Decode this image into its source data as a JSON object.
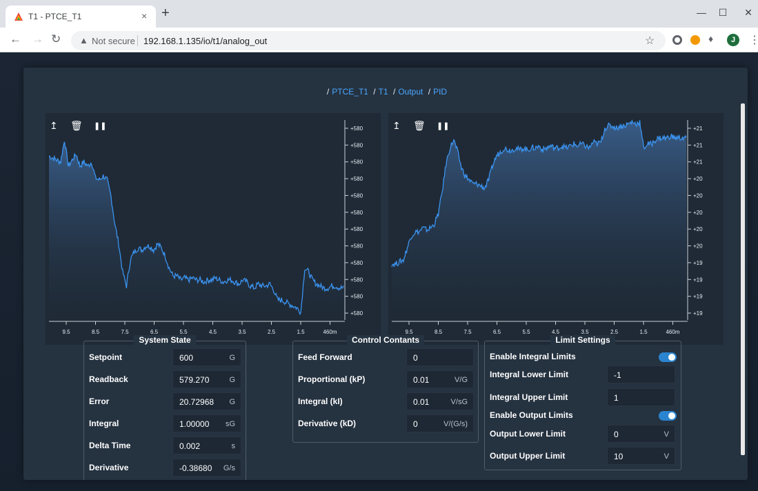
{
  "browser": {
    "tab_title": "T1 - PTCE_T1",
    "tab_close": "×",
    "new_tab": "+",
    "security_label": "Not secure",
    "url": "192.168.1.135/io/t1/analog_out",
    "avatar_letter": "J"
  },
  "breadcrumb": [
    "PTCE_T1",
    "T1",
    "Output",
    "PID"
  ],
  "charts": {
    "x_ticks": [
      "9.5",
      "8.5",
      "7.5",
      "6.5",
      "5.5",
      "4.5",
      "3.5",
      "2.5",
      "1.5",
      "460m"
    ],
    "line_color": "#3b93f0"
  },
  "chart_data": [
    {
      "type": "area",
      "x_ticks": [
        "9.5",
        "8.5",
        "7.5",
        "6.5",
        "5.5",
        "4.5",
        "3.5",
        "2.5",
        "1.5",
        "460m"
      ],
      "y_ticks": [
        "+580",
        "+580",
        "+580",
        "+580",
        "+580",
        "+580",
        "+580",
        "+580",
        "+580",
        "+580",
        "+580",
        "+580"
      ],
      "series": [
        {
          "values": [
            0.82,
            0.81,
            0.8,
            0.79,
            0.9,
            0.77,
            0.8,
            0.83,
            0.77,
            0.79,
            0.77,
            0.79,
            0.71,
            0.7,
            0.72,
            0.7,
            0.62,
            0.48,
            0.38,
            0.24,
            0.17,
            0.3,
            0.34,
            0.36,
            0.35,
            0.37,
            0.37,
            0.35,
            0.38,
            0.36,
            0.32,
            0.26,
            0.22,
            0.22,
            0.2,
            0.21,
            0.2,
            0.21,
            0.2,
            0.2,
            0.19,
            0.2,
            0.2,
            0.21,
            0.2,
            0.19,
            0.2,
            0.2,
            0.19,
            0.18,
            0.2,
            0.19,
            0.17,
            0.16,
            0.18,
            0.17,
            0.17,
            0.18,
            0.15,
            0.1,
            0.1,
            0.09,
            0.08,
            0.07,
            0.06,
            0.04,
            0.26,
            0.24,
            0.2,
            0.18,
            0.17,
            0.16,
            0.16,
            0.17,
            0.17,
            0.16,
            0.16
          ]
        }
      ]
    },
    {
      "type": "area",
      "x_ticks": [
        "9.5",
        "8.5",
        "7.5",
        "6.5",
        "5.5",
        "4.5",
        "3.5",
        "2.5",
        "1.5",
        "460m"
      ],
      "y_ticks": [
        "+21",
        "+21",
        "+21",
        "+20",
        "+20",
        "+20",
        "+20",
        "+20",
        "+19",
        "+19",
        "+19",
        "+19"
      ],
      "series": [
        {
          "values": [
            0.28,
            0.28,
            0.29,
            0.3,
            0.36,
            0.42,
            0.44,
            0.44,
            0.46,
            0.45,
            0.46,
            0.48,
            0.53,
            0.64,
            0.78,
            0.86,
            0.9,
            0.84,
            0.76,
            0.72,
            0.7,
            0.68,
            0.68,
            0.67,
            0.66,
            0.7,
            0.77,
            0.82,
            0.84,
            0.86,
            0.85,
            0.85,
            0.86,
            0.85,
            0.86,
            0.85,
            0.86,
            0.86,
            0.87,
            0.85,
            0.86,
            0.87,
            0.86,
            0.86,
            0.87,
            0.86,
            0.87,
            0.88,
            0.87,
            0.88,
            0.87,
            0.86,
            0.89,
            0.88,
            0.89,
            0.96,
            0.97,
            0.97,
            0.96,
            0.97,
            0.97,
            0.98,
            0.99,
            0.98,
            0.99,
            0.86,
            0.88,
            0.88,
            0.9,
            0.91,
            0.91,
            0.91,
            0.92,
            0.91,
            0.91,
            0.91,
            0.91
          ]
        }
      ]
    }
  ],
  "system_state": {
    "title": "System State",
    "rows": [
      {
        "label": "Setpoint",
        "value": "600",
        "unit": "G"
      },
      {
        "label": "Readback",
        "value": "579.270",
        "unit": "G"
      },
      {
        "label": "Error",
        "value": "20.72968",
        "unit": "G"
      },
      {
        "label": "Integral",
        "value": "1.00000",
        "unit": "sG"
      },
      {
        "label": "Delta Time",
        "value": "0.002",
        "unit": "s"
      },
      {
        "label": "Derivative",
        "value": "-0.38680",
        "unit": "G/s"
      }
    ]
  },
  "control": {
    "title": "Control Contants",
    "rows": [
      {
        "label": "Feed Forward",
        "value": "0",
        "unit": ""
      },
      {
        "label": "Proportional (kP)",
        "value": "0.01",
        "unit": "V/G"
      },
      {
        "label": "Integral (kI)",
        "value": "0.01",
        "unit": "V/sG"
      },
      {
        "label": "Derivative (kD)",
        "value": "0",
        "unit": "V/(G/s)"
      }
    ]
  },
  "limits": {
    "title": "Limit Settings",
    "enable_integral_label": "Enable Integral Limits",
    "integral_lower_label": "Integral Lower Limit",
    "integral_lower_value": "-1",
    "integral_upper_label": "Integral Upper Limit",
    "integral_upper_value": "1",
    "enable_output_label": "Enable Output Limits",
    "output_lower_label": "Output Lower Limit",
    "output_lower_value": "0",
    "output_lower_unit": "V",
    "output_upper_label": "Output Upper Limit",
    "output_upper_value": "10",
    "output_upper_unit": "V"
  }
}
